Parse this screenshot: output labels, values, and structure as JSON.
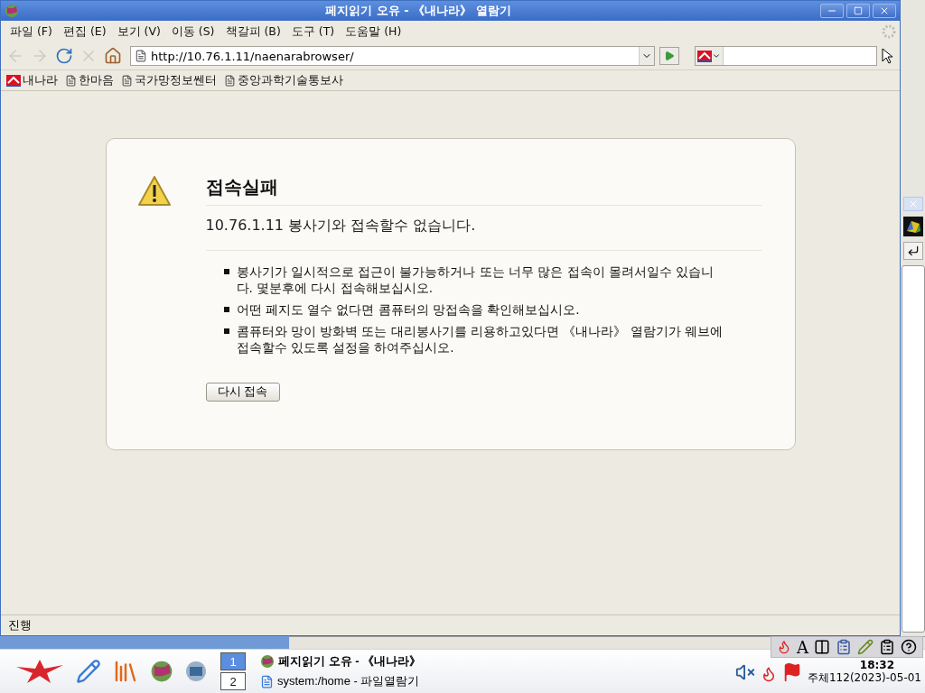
{
  "window": {
    "title": "페지읽기 오유 - 《내나라》 열람기"
  },
  "menu": [
    {
      "label": "파일 (F)"
    },
    {
      "label": "편집 (E)"
    },
    {
      "label": "보기 (V)"
    },
    {
      "label": "이동 (S)"
    },
    {
      "label": "책갈피 (B)"
    },
    {
      "label": "도구 (T)"
    },
    {
      "label": "도움말 (H)"
    }
  ],
  "navigation": [
    {
      "kind": "back",
      "disabled": true
    },
    {
      "kind": "forward",
      "disabled": true
    },
    {
      "kind": "reload",
      "disabled": false
    },
    {
      "kind": "stop",
      "disabled": true
    },
    {
      "kind": "home",
      "disabled": false
    }
  ],
  "address": {
    "value": "http://10.76.1.11/naenarabrowser/"
  },
  "bookmarks": [
    {
      "kind": "logo",
      "label": "내나라"
    },
    {
      "kind": "page",
      "label": "한마음"
    },
    {
      "kind": "page",
      "label": "국가망정보쎈터"
    },
    {
      "kind": "page",
      "label": "중앙과학기술통보사"
    }
  ],
  "error": {
    "title": "접속실패",
    "message": "10.76.1.11 봉사기와 접속할수 없습니다.",
    "bullets": [
      "봉사기가 일시적으로 접근이 불가능하거나 또는 너무 많은 접속이 몰려서일수 있습니다. 몇분후에 다시 접속해보십시오.",
      "어떤 페지도 열수 없다면 콤퓨터의 망접속을 확인해보십시오.",
      "콤퓨터와 망이 방화벽 또는 대리봉사기를 리용하고있다면 《내나라》 열람기가 웨브에 접속할수 있도록 설정을 하여주십시오."
    ],
    "button": "다시 접속"
  },
  "status_bar": "진행",
  "taskbar": {
    "desktops": [
      {
        "label": "1",
        "selected": true
      },
      {
        "label": "2",
        "selected": false
      }
    ],
    "tasks": [
      {
        "label": "페지읽기 오유 - 《내나라》",
        "selected": true
      },
      {
        "label": "system:/home - 파일열람기",
        "selected": false
      }
    ],
    "input_indicator": "A",
    "time": "18:32",
    "date": "주체112(2023)-05-01"
  }
}
